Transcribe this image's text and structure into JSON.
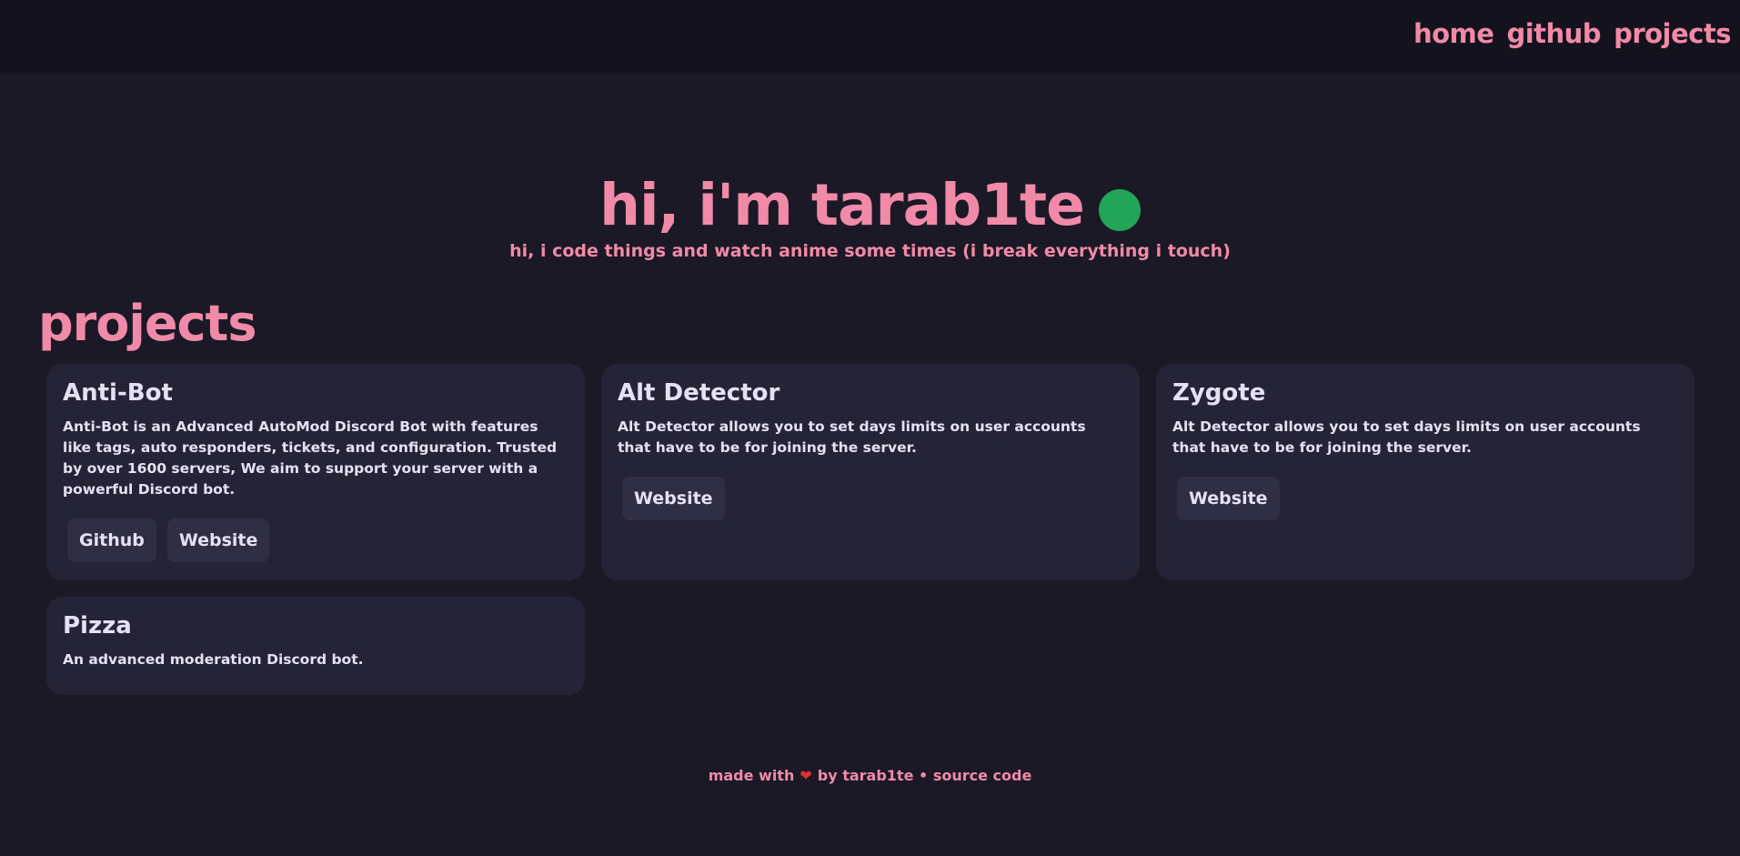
{
  "nav": {
    "items": [
      "home",
      "github",
      "projects"
    ]
  },
  "hero": {
    "title": "hi, i'm tarab1te",
    "subtitle": "hi, i code things and watch anime some times (i break everything i touch)",
    "status_color": "#22a559"
  },
  "projects": {
    "heading": "projects",
    "items": [
      {
        "title": "Anti-Bot",
        "description": "Anti-Bot is an Advanced AutoMod Discord Bot with features like tags, auto responders, tickets, and configuration. Trusted by over 1600 servers, We aim to support your server with a powerful Discord bot.",
        "buttons": [
          "Github",
          "Website"
        ]
      },
      {
        "title": "Alt Detector",
        "description": "Alt Detector allows you to set days limits on user accounts that have to be for joining the server.",
        "buttons": [
          "Website"
        ]
      },
      {
        "title": "Zygote",
        "description": "Alt Detector allows you to set days limits on user accounts that have to be for joining the server.",
        "buttons": [
          "Website"
        ]
      },
      {
        "title": "Pizza",
        "description": "An advanced moderation Discord bot.",
        "buttons": []
      }
    ]
  },
  "footer": {
    "made_with": "made with",
    "heart_icon": "heart-icon",
    "by_text": "by tarab1te",
    "separator": "•",
    "source_link": "source code"
  },
  "colors": {
    "accent": "#f08aa8",
    "background": "#1a1925",
    "topbar": "#14131d",
    "card": "#252336",
    "button": "#302e44",
    "text": "#e4e1f5",
    "heart": "#e5302f"
  }
}
